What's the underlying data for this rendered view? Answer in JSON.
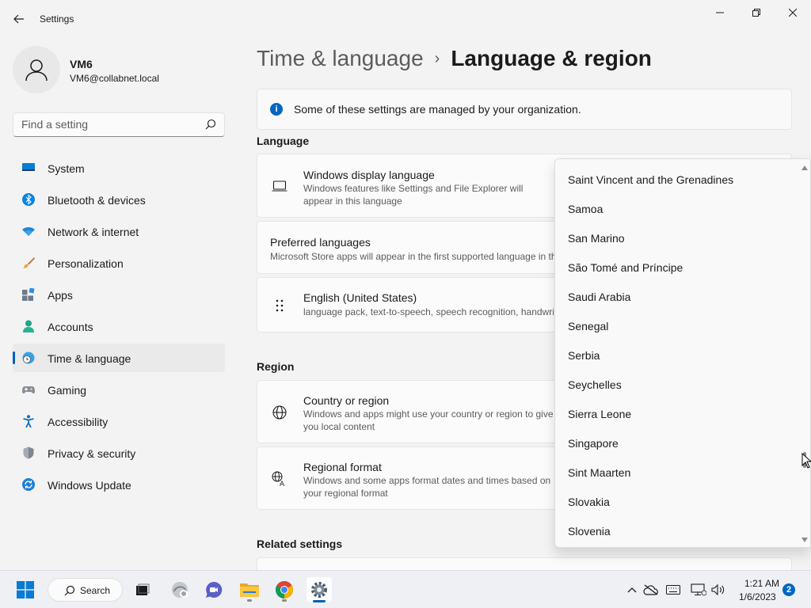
{
  "window": {
    "title": "Settings",
    "controls": [
      "minimize",
      "maximize",
      "close"
    ]
  },
  "user": {
    "name": "VM6",
    "email": "VM6@collabnet.local"
  },
  "search": {
    "placeholder": "Find a setting"
  },
  "sidebar": {
    "items": [
      {
        "label": "System",
        "icon": "system-icon",
        "active": false
      },
      {
        "label": "Bluetooth & devices",
        "icon": "bluetooth-icon",
        "active": false
      },
      {
        "label": "Network & internet",
        "icon": "wifi-icon",
        "active": false
      },
      {
        "label": "Personalization",
        "icon": "brush-icon",
        "active": false
      },
      {
        "label": "Apps",
        "icon": "apps-icon",
        "active": false
      },
      {
        "label": "Accounts",
        "icon": "person-icon",
        "active": false
      },
      {
        "label": "Time & language",
        "icon": "globe-clock-icon",
        "active": true
      },
      {
        "label": "Gaming",
        "icon": "controller-icon",
        "active": false
      },
      {
        "label": "Accessibility",
        "icon": "accessibility-icon",
        "active": false
      },
      {
        "label": "Privacy & security",
        "icon": "shield-icon",
        "active": false
      },
      {
        "label": "Windows Update",
        "icon": "update-icon",
        "active": false
      }
    ]
  },
  "breadcrumb": {
    "parent": "Time & language",
    "separator": "›",
    "current": "Language & region"
  },
  "info": {
    "text": "Some of these settings are managed by your organization."
  },
  "language_section": {
    "heading": "Language",
    "display_language": {
      "title": "Windows display language",
      "desc": "Windows features like Settings and File Explorer will appear in this language"
    },
    "preferred": {
      "title": "Preferred languages",
      "desc": "Microsoft Store apps will appear in the first supported language in this list"
    },
    "english": {
      "title": "English (United States)",
      "desc": "language pack, text-to-speech, speech recognition, handwriting, basic typing"
    }
  },
  "region_section": {
    "heading": "Region",
    "country": {
      "title": "Country or region",
      "desc": "Windows and apps might use your country or region to give you local content"
    },
    "format": {
      "title": "Regional format",
      "desc": "Windows and some apps format dates and times based on your regional format"
    }
  },
  "related": {
    "heading": "Related settings"
  },
  "dropdown": {
    "items": [
      "Saint Vincent and the Grenadines",
      "Samoa",
      "San Marino",
      "São Tomé and Príncipe",
      "Saudi Arabia",
      "Senegal",
      "Serbia",
      "Seychelles",
      "Sierra Leone",
      "Singapore",
      "Sint Maarten",
      "Slovakia",
      "Slovenia"
    ]
  },
  "taskbar": {
    "search_label": "Search",
    "time": "1:21 AM",
    "date": "1/6/2023",
    "notification_count": "2",
    "accent": "#005fb8"
  }
}
